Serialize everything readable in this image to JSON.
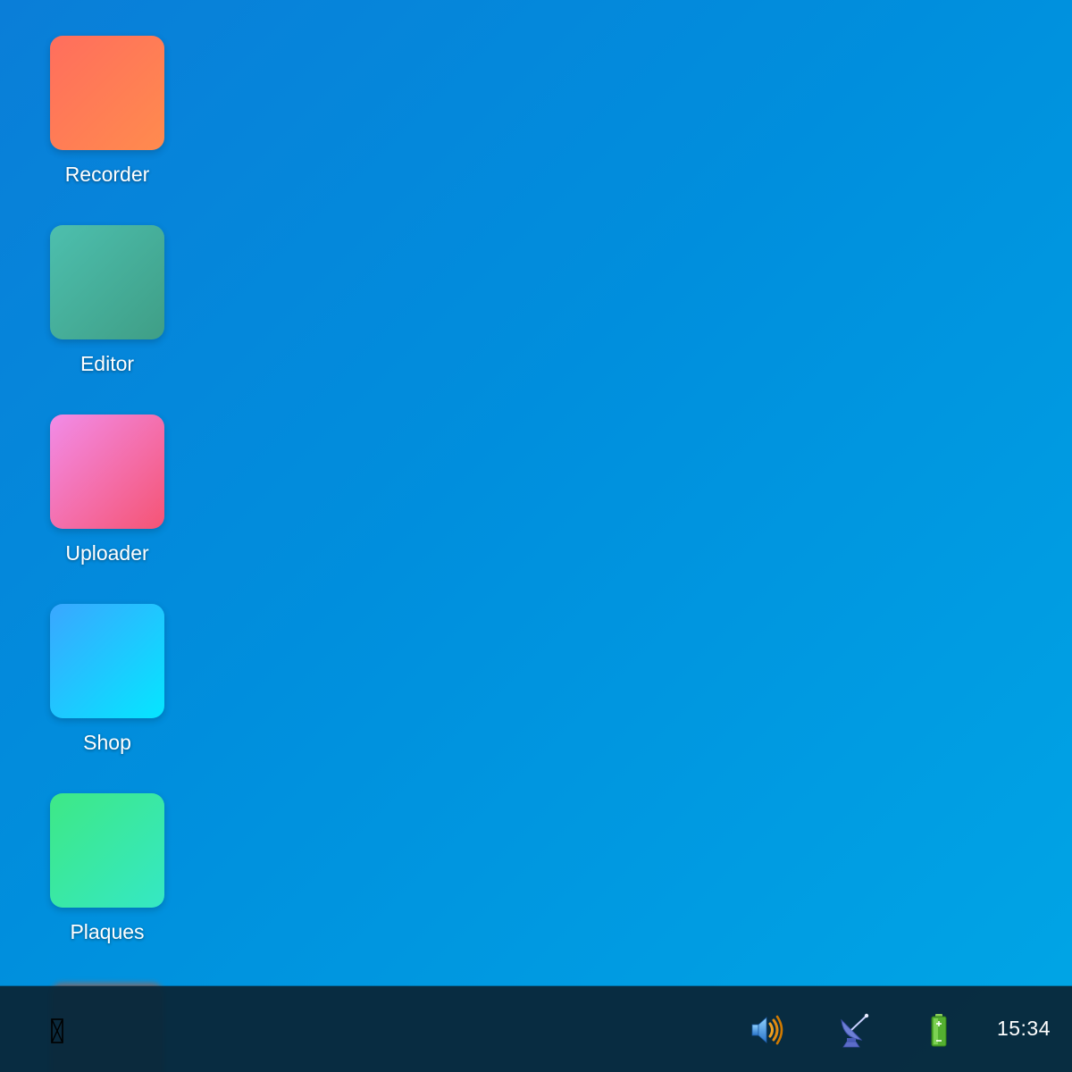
{
  "desktop": {
    "apps": [
      {
        "label": "Recorder",
        "icon": "recorder-app-icon",
        "gradient": [
          "#ff6e5d",
          "#ff8b4e"
        ]
      },
      {
        "label": "Editor",
        "icon": "editor-app-icon",
        "gradient": [
          "#4dbfae",
          "#3f9e86"
        ]
      },
      {
        "label": "Uploader",
        "icon": "uploader-app-icon",
        "gradient": [
          "#f28ce8",
          "#f55474"
        ]
      },
      {
        "label": "Shop",
        "icon": "shop-app-icon",
        "gradient": [
          "#3aa7ff",
          "#05e6ff"
        ]
      },
      {
        "label": "Plaques",
        "icon": "plaques-app-icon",
        "gradient": [
          "#3ee886",
          "#35e8c4"
        ]
      }
    ]
  },
  "taskbar": {
    "start_icon": "start-menu-icon",
    "tray": {
      "volume_icon": "volume-icon",
      "network_icon": "satellite-dish-icon",
      "battery_icon": "battery-icon"
    },
    "clock": "15:34"
  },
  "colors": {
    "taskbar_bg": "#08283a",
    "text": "#ffffff"
  }
}
